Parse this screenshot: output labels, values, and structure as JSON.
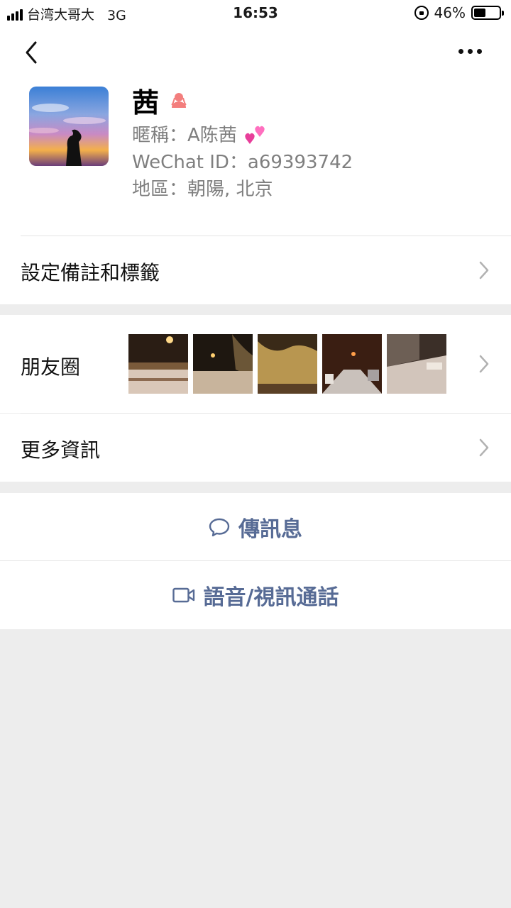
{
  "status_bar": {
    "carrier": "台湾大哥大",
    "network": "3G",
    "time": "16:53",
    "battery": "46%",
    "battery_level": 0.46
  },
  "header": {
    "back_icon": "chevron-left-icon",
    "more_icon": "more-dots-icon"
  },
  "profile": {
    "name": "茜",
    "gender_icon": "female-icon",
    "nickname": "暱稱：A陈茜",
    "nickname_icon": "two-hearts-icon",
    "wechat_id": "WeChat ID：a69393742",
    "region": "地區：朝陽, 北京"
  },
  "cells": {
    "remark": "設定備註和標籤",
    "moments": "朋友圈",
    "more_info": "更多資訊"
  },
  "actions": {
    "message": "傳訊息",
    "call": "語音/視訊通話"
  },
  "colors": {
    "link_blue": "#576b95",
    "background": "#ededed",
    "gender_pink": "#f37e7d"
  }
}
